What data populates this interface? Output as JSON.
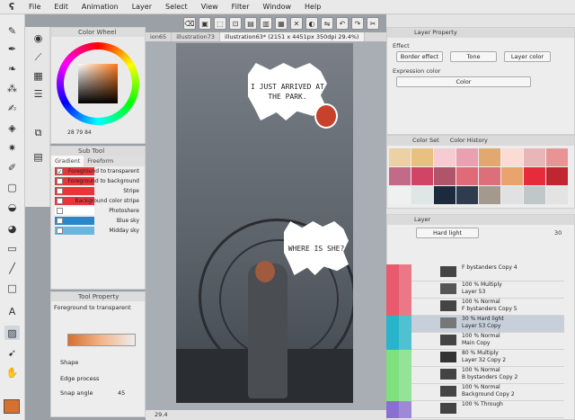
{
  "menu": {
    "logo": "ʕ",
    "items": [
      "File",
      "Edit",
      "Animation",
      "Layer",
      "Select",
      "View",
      "Filter",
      "Window",
      "Help"
    ]
  },
  "command_bar": {
    "icons": [
      "clear-icon",
      "paint-icon",
      "select-icon",
      "select-icon",
      "new-icon",
      "open-icon",
      "save-icon",
      "close-icon",
      "color-icon",
      "flip-icon",
      "undo-icon",
      "redo-icon",
      "cut-icon"
    ]
  },
  "tools": [
    "pen",
    "ink",
    "brush",
    "airbrush",
    "blend",
    "figure",
    "sparkle",
    "text",
    "shape",
    "gradient",
    "fill",
    "eraser",
    "lasso",
    "text-tool",
    "gradient-tool",
    "move",
    "hand"
  ],
  "color_wheel": {
    "title": "Color Wheel",
    "values": "28 79 84"
  },
  "sub_tool": {
    "tabs": [
      "Gradient",
      "Freeform"
    ],
    "items": [
      {
        "label": "Foreground to transparent",
        "color": "#e7353a",
        "checked": true
      },
      {
        "label": "Foreground to background",
        "color": "#e7353a",
        "checked": false
      },
      {
        "label": "Stripe",
        "color": "#e7353a",
        "checked": false
      },
      {
        "label": "Background color stripe",
        "color": "#e7353a",
        "checked": false
      },
      {
        "label": "Photoshere",
        "color": "#ffffff",
        "checked": false
      },
      {
        "label": "Blue sky",
        "color": "#2c86c8",
        "checked": false
      },
      {
        "label": "Midday sky",
        "color": "#67b7e3",
        "checked": false
      }
    ]
  },
  "tool_property": {
    "title": "Tool Property",
    "current": "Foreground to transparent",
    "shape_label": "Shape",
    "edge_label": "Edge process",
    "snap_label": "Snap angle",
    "snap_value": "45"
  },
  "document_tabs": [
    "ion65",
    "illustration73",
    "illustration63* (2151 x 4451px 350dpi 29.4%)"
  ],
  "canvas": {
    "bubble1": "I JUST ARRIVED AT THE PARK.",
    "bubble2": "WHERE IS SHE?"
  },
  "status": {
    "zoom": "29.4"
  },
  "layer_property": {
    "title": "Layer Property",
    "effect_label": "Effect",
    "border_effect": "Border effect",
    "tone": "Tone",
    "layer_color": "Layer color",
    "expression_label": "Expression color",
    "expression_value": "Color"
  },
  "color_history": {
    "tabs": [
      "Color Set",
      "Color History"
    ],
    "swatches": [
      "#ecd1a4",
      "#e8c07f",
      "#f5ccd1",
      "#e9a0b2",
      "#e1a870",
      "#fbdcd4",
      "#e8b6b6",
      "#e99494",
      "#c26b89",
      "#d24465",
      "#b0546a",
      "#e16a79",
      "#dc6f7a",
      "#e9a46e",
      "#e62b3c",
      "#c0262f",
      "#eef1ef",
      "#dfe6e6",
      "#1c2a3e",
      "#2f3c4e",
      "#a3998c",
      "#e0e2e1",
      "#bfc7c9",
      "#e3e4e2"
    ]
  },
  "layer": {
    "title": "Layer",
    "blend_mode": "Hard light",
    "opacity": "30",
    "rows": [
      {
        "name": "F bystanders Copy 4",
        "mode": "",
        "thumb": "#444444",
        "selected": false
      },
      {
        "name": "Layer 53",
        "mode": "100 % Multiply",
        "thumb": "#555555",
        "selected": false
      },
      {
        "name": "F bystanders Copy 5",
        "mode": "100 % Normal",
        "thumb": "#444444",
        "selected": false
      },
      {
        "name": "Layer 53 Copy",
        "mode": "30 % Hard light",
        "thumb": "#777777",
        "selected": true
      },
      {
        "name": "Main Copy",
        "mode": "100 % Normal",
        "thumb": "#444444",
        "selected": false
      },
      {
        "name": "Layer 32 Copy 2",
        "mode": "80 % Multiply",
        "thumb": "#333333",
        "selected": false
      },
      {
        "name": "B bystanders Copy 2",
        "mode": "100 % Normal",
        "thumb": "#444444",
        "selected": false
      },
      {
        "name": "Background Copy 2",
        "mode": "100 % Normal",
        "thumb": "#444444",
        "selected": false
      },
      {
        "name": "",
        "mode": "100 % Through",
        "thumb": "#444444",
        "selected": false
      }
    ]
  },
  "colors": {
    "red_label": "#e85a6d",
    "cyan_label": "#28b5c9",
    "green_label": "#7ee07f",
    "purple_label": "#8b6fd0",
    "main_color": "#d6702f"
  }
}
